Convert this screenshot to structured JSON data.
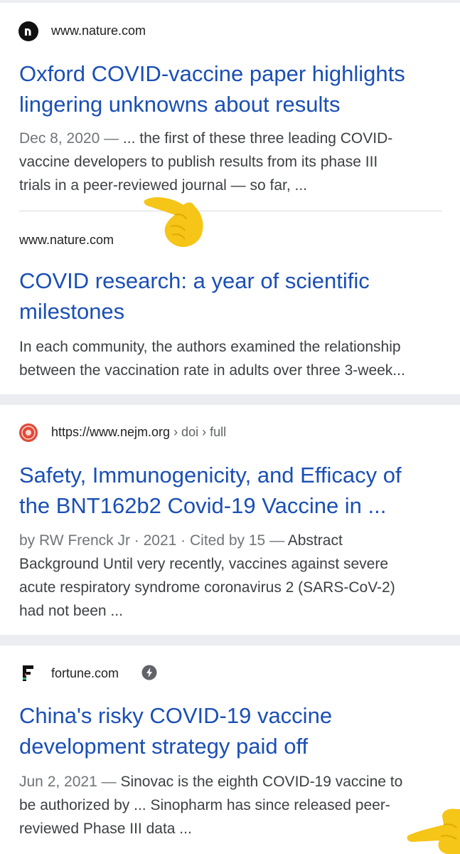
{
  "results": [
    {
      "site": "www.nature.com",
      "icon": "nature-n-icon",
      "title_line1": "Oxford COVID-vaccine paper highlights",
      "title_line2": "lingering unknowns about results",
      "date": "Dec 8, 2020",
      "dash": " — ",
      "snippet_line1": "... the first of these three leading COVID-",
      "snippet_line2": "vaccine developers to publish results from its phase III",
      "snippet_line3": "trials in a peer-reviewed journal — so far, ..."
    },
    {
      "site": "www.nature.com",
      "title_line1": "COVID research: a year of scientific",
      "title_line2": "milestones",
      "snippet_line1": "In each community, the authors examined the relationship",
      "snippet_line2": "between the vaccination rate in adults over three 3-week..."
    },
    {
      "site": "https://www.nejm.org",
      "crumb": " › doi › full",
      "icon": "nejm-seal-icon",
      "title_line1": "Safety, Immunogenicity, and Efficacy of",
      "title_line2": "the BNT162b2 Covid-19 Vaccine in ...",
      "meta": "by RW Frenck Jr · 2021 · Cited by 15",
      "dash": " — ",
      "snippet_line1_rest": "Abstract",
      "snippet_line2": "Background Until very recently, vaccines against severe",
      "snippet_line3": "acute respiratory syndrome coronavirus 2 (SARS-CoV-2)",
      "snippet_line4": "had not been ..."
    },
    {
      "site": "fortune.com",
      "icon": "fortune-f-icon",
      "amp_icon": "amp-lightning-icon",
      "title_line1": "China's risky COVID-19 vaccine",
      "title_line2": "development strategy paid off",
      "date": "Jun 2, 2021",
      "dash": " — ",
      "snippet_line1_rest": "Sinovac is the eighth COVID-19 vaccine to",
      "snippet_line2": "be authorized by ... Sinopharm has since released peer-",
      "snippet_line3": "reviewed Phase III data ..."
    }
  ],
  "annotations": {
    "emoji": "pointing-hand-emoji",
    "color": "#f5c518"
  },
  "colors": {
    "title": "#1a4fb5",
    "snippet": "#3c4043",
    "meta": "#70757a",
    "background": "#ecedf1"
  }
}
